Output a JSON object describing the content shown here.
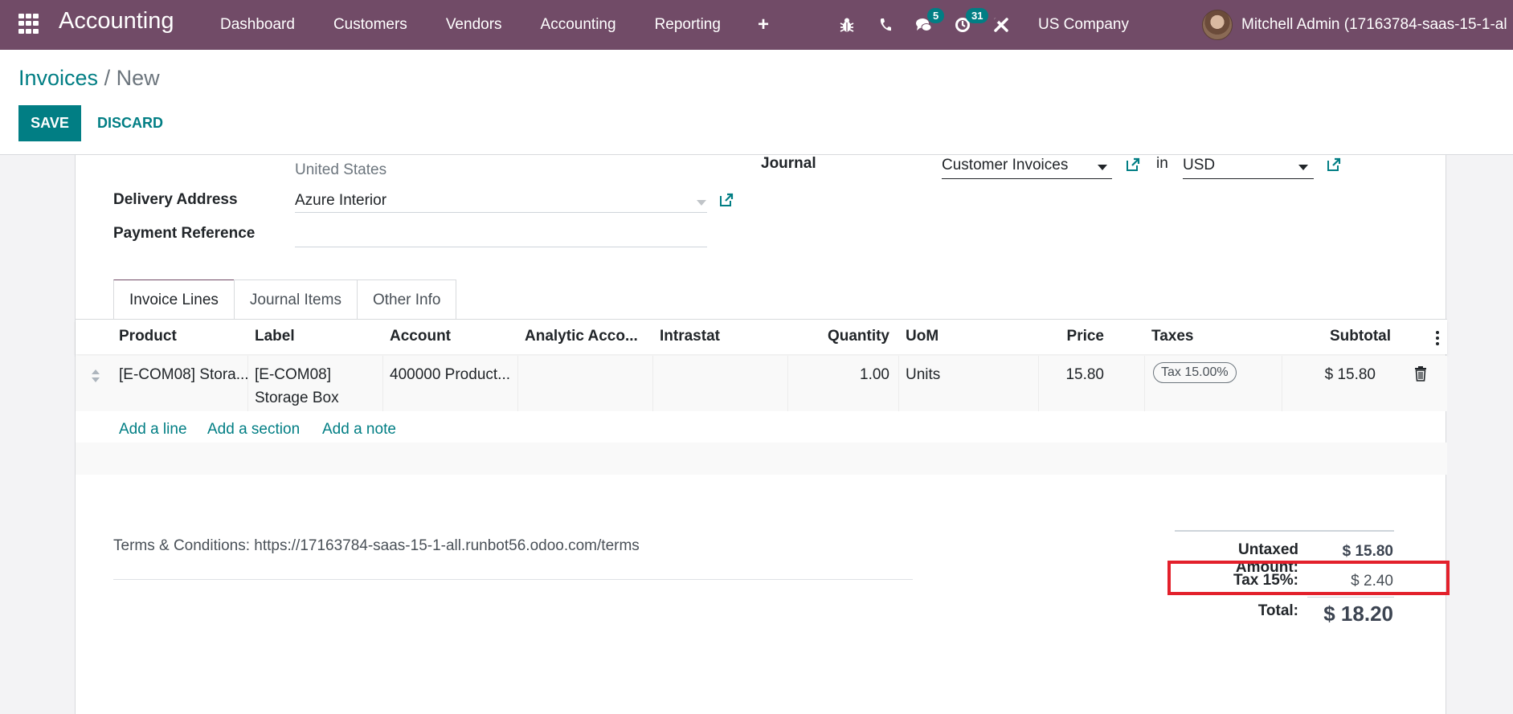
{
  "navbar": {
    "app_title": "Accounting",
    "menu": [
      "Dashboard",
      "Customers",
      "Vendors",
      "Accounting",
      "Reporting"
    ],
    "plus_label": "+",
    "messages_count": "5",
    "activities_count": "31",
    "company": "US Company",
    "user": "Mitchell Admin (17163784-saas-15-1-al",
    "brand_color": "#714B67"
  },
  "control_panel": {
    "breadcrumb_parent": "Invoices",
    "breadcrumb_separator": " / ",
    "breadcrumb_current": "New",
    "save_label": "SAVE",
    "discard_label": "DISCARD",
    "accent_color": "#017e84"
  },
  "form": {
    "address_country": "United States",
    "delivery_address_label": "Delivery Address",
    "delivery_address_value": "Azure Interior",
    "payment_reference_label": "Payment Reference",
    "payment_reference_value": "",
    "journal_label": "Journal",
    "journal_value": "Customer Invoices",
    "in_label": "in",
    "currency_value": "USD"
  },
  "tabs": [
    {
      "label": "Invoice Lines",
      "active": true
    },
    {
      "label": "Journal Items",
      "active": false
    },
    {
      "label": "Other Info",
      "active": false
    }
  ],
  "table": {
    "headers": [
      "Product",
      "Label",
      "Account",
      "Analytic Acco...",
      "Intrastat",
      "Quantity",
      "UoM",
      "Price",
      "Taxes",
      "Subtotal"
    ],
    "rows": [
      {
        "product": "[E-COM08] Stora...",
        "label_line1": "[E-COM08]",
        "label_line2": "Storage Box",
        "account": "400000 Product...",
        "analytic": "",
        "intrastat": "",
        "quantity": "1.00",
        "uom": "Units",
        "price": "15.80",
        "tax": "Tax 15.00%",
        "subtotal": "$ 15.80"
      }
    ],
    "add_line": "Add a line",
    "add_section": "Add a section",
    "add_note": "Add a note"
  },
  "footer": {
    "terms": "Terms & Conditions: https://17163784-saas-15-1-all.runbot56.odoo.com/terms",
    "untaxed_label": "Untaxed Amount:",
    "untaxed_value": "$ 15.80",
    "tax_label": "Tax 15%:",
    "tax_value": "$ 2.40",
    "total_label": "Total:",
    "total_value": "$ 18.20",
    "highlight_color": "#e3202b"
  }
}
